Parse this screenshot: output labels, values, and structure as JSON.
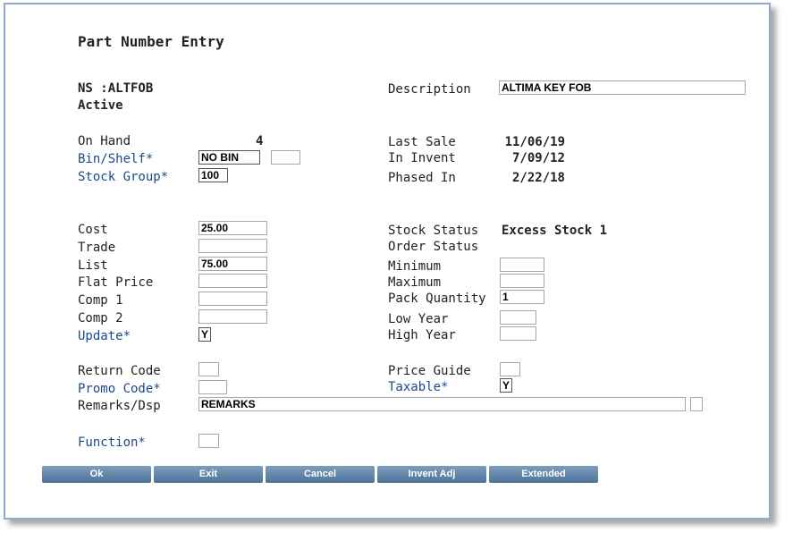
{
  "title": "Part Number Entry",
  "part": {
    "number": "NS :ALTFOB",
    "status": "Active"
  },
  "description": {
    "label": "Description",
    "value": "ALTIMA KEY FOB"
  },
  "left": {
    "on_hand": {
      "label": "On Hand",
      "value": "4"
    },
    "bin_shelf": {
      "label": "Bin/Shelf*",
      "value": "NO BIN",
      "value2": ""
    },
    "stock_group": {
      "label": "Stock Group*",
      "value": "100"
    },
    "cost": {
      "label": "Cost",
      "value": "25.00"
    },
    "trade": {
      "label": "Trade",
      "value": ""
    },
    "list": {
      "label": "List",
      "value": "75.00"
    },
    "flat_price": {
      "label": "Flat Price",
      "value": ""
    },
    "comp1": {
      "label": "Comp 1",
      "value": ""
    },
    "comp2": {
      "label": "Comp 2",
      "value": ""
    },
    "update": {
      "label": "Update*",
      "value": "Y"
    },
    "return_code": {
      "label": "Return Code",
      "value": ""
    },
    "promo_code": {
      "label": "Promo Code*",
      "value": ""
    },
    "remarks": {
      "label": "Remarks/Dsp",
      "value": "REMARKS",
      "value2": ""
    },
    "function": {
      "label": "Function*",
      "value": ""
    }
  },
  "right": {
    "last_sale": {
      "label": "Last Sale",
      "value": "11/06/19"
    },
    "in_invent": {
      "label": "In Invent",
      "value": "7/09/12"
    },
    "phased_in": {
      "label": "Phased In",
      "value": "2/22/18"
    },
    "stock_status": {
      "label": "Stock Status",
      "value": "Excess Stock 1"
    },
    "order_status": {
      "label": "Order Status",
      "value": ""
    },
    "minimum": {
      "label": "Minimum",
      "value": ""
    },
    "maximum": {
      "label": "Maximum",
      "value": ""
    },
    "pack_quantity": {
      "label": "Pack Quantity",
      "value": "1"
    },
    "low_year": {
      "label": "Low Year",
      "value": ""
    },
    "high_year": {
      "label": "High Year",
      "value": ""
    },
    "price_guide": {
      "label": "Price Guide",
      "value": ""
    },
    "taxable": {
      "label": "Taxable*",
      "value": "Y"
    }
  },
  "buttons": {
    "ok": "Ok",
    "exit": "Exit",
    "cancel": "Cancel",
    "invent_adj": "Invent Adj",
    "extended": "Extended"
  },
  "colors": {
    "link": "#1a4a8a",
    "button": "#5b7fa3",
    "window_border": "#8fa9d6"
  }
}
